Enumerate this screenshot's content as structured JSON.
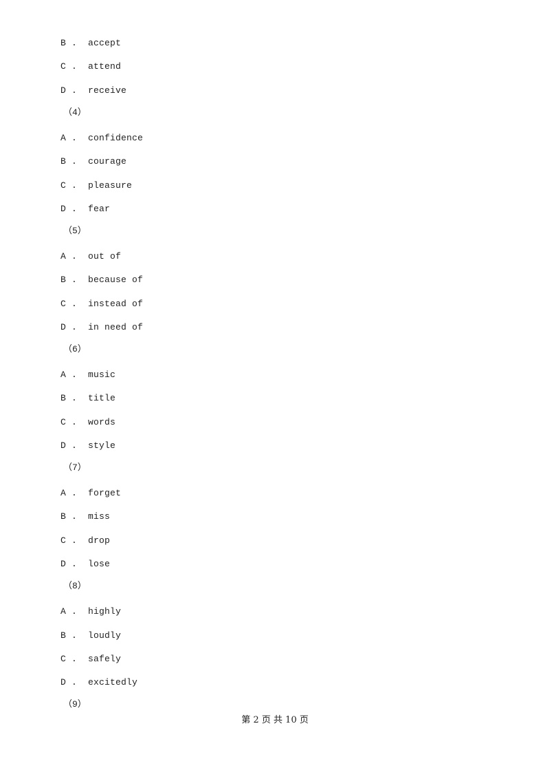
{
  "leading_options": [
    {
      "letter": "B",
      "text": "accept"
    },
    {
      "letter": "C",
      "text": "attend"
    },
    {
      "letter": "D",
      "text": "receive"
    }
  ],
  "questions": [
    {
      "number": "（4）",
      "options": [
        {
          "letter": "A",
          "text": "confidence"
        },
        {
          "letter": "B",
          "text": "courage"
        },
        {
          "letter": "C",
          "text": "pleasure"
        },
        {
          "letter": "D",
          "text": "fear"
        }
      ]
    },
    {
      "number": "（5）",
      "options": [
        {
          "letter": "A",
          "text": "out of"
        },
        {
          "letter": "B",
          "text": "because of"
        },
        {
          "letter": "C",
          "text": "instead of"
        },
        {
          "letter": "D",
          "text": "in need of"
        }
      ]
    },
    {
      "number": "（6）",
      "options": [
        {
          "letter": "A",
          "text": "music"
        },
        {
          "letter": "B",
          "text": "title"
        },
        {
          "letter": "C",
          "text": "words"
        },
        {
          "letter": "D",
          "text": "style"
        }
      ]
    },
    {
      "number": "（7）",
      "options": [
        {
          "letter": "A",
          "text": "forget"
        },
        {
          "letter": "B",
          "text": "miss"
        },
        {
          "letter": "C",
          "text": "drop"
        },
        {
          "letter": "D",
          "text": "lose"
        }
      ]
    },
    {
      "number": "（8）",
      "options": [
        {
          "letter": "A",
          "text": "highly"
        },
        {
          "letter": "B",
          "text": "loudly"
        },
        {
          "letter": "C",
          "text": "safely"
        },
        {
          "letter": "D",
          "text": "excitedly"
        }
      ]
    },
    {
      "number": "（9）",
      "options": []
    }
  ],
  "footer": {
    "text": "第 2 页 共 10 页"
  }
}
